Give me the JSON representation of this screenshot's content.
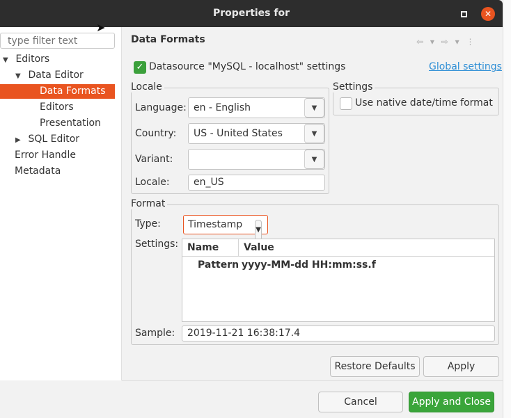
{
  "window": {
    "title": "Properties for",
    "maximize_icon": "maximize-icon",
    "close_icon": "close-icon"
  },
  "sidebar": {
    "filter_placeholder": "type filter text",
    "tree": [
      {
        "label": "Editors",
        "arrow": "▼"
      },
      {
        "label": "Data Editor",
        "arrow": "▼"
      },
      {
        "label": "Data Formats",
        "arrow": ""
      },
      {
        "label": "Editors",
        "arrow": ""
      },
      {
        "label": "Presentation",
        "arrow": ""
      },
      {
        "label": "SQL Editor",
        "arrow": "▶"
      },
      {
        "label": "Error Handle",
        "arrow": ""
      },
      {
        "label": "Metadata",
        "arrow": ""
      }
    ]
  },
  "page": {
    "title": "Data Formats",
    "nav": {
      "back": "⇦",
      "back_menu": "▾",
      "forward": "⇨",
      "forward_menu": "▾",
      "more": "⋮"
    }
  },
  "datasource": {
    "checked": true,
    "label": "Datasource \"MySQL - localhost\" settings",
    "global_link": "Global settings"
  },
  "locale": {
    "group_title": "Locale",
    "language_label": "Language:",
    "language_value": "en - English",
    "country_label": "Country:",
    "country_value": "US - United States",
    "variant_label": "Variant:",
    "variant_value": "",
    "locale_label": "Locale:",
    "locale_value": "en_US"
  },
  "settings": {
    "group_title": "Settings",
    "native_label": "Use native date/time format",
    "native_checked": false
  },
  "format": {
    "group_title": "Format",
    "type_label": "Type:",
    "type_value": "Timestamp",
    "settings_label": "Settings:",
    "columns": [
      "Name",
      "Value"
    ],
    "rows": [
      {
        "name": "Pattern",
        "value": "yyyy-MM-dd HH:mm:ss.f"
      }
    ],
    "sample_label": "Sample:",
    "sample_value": "2019-11-21 16:38:17.4"
  },
  "buttons": {
    "restore": "Restore Defaults",
    "apply": "Apply",
    "cancel": "Cancel",
    "apply_close": "Apply and Close"
  },
  "colors": {
    "accent": "#e95420",
    "primary": "#3aa53a",
    "link": "#2f8fd6"
  }
}
